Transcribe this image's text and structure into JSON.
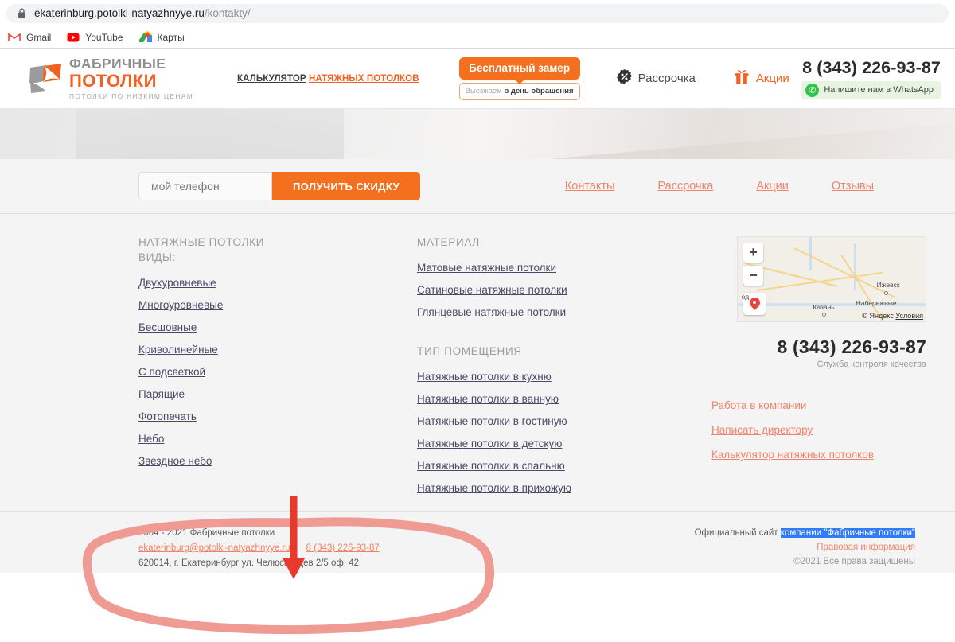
{
  "browser": {
    "lock_icon": "lock-icon",
    "url_host": "ekaterinburg.potolki-natyazhnyye.ru",
    "url_path": "/kontakty/",
    "bookmarks": [
      {
        "label": "Gmail",
        "icon": "gmail-icon"
      },
      {
        "label": "YouTube",
        "icon": "youtube-icon"
      },
      {
        "label": "Карты",
        "icon": "google-maps-icon"
      }
    ]
  },
  "header": {
    "logo": {
      "line1": "ФАБРИЧНЫЕ",
      "line2": "ПОТОЛКИ",
      "tagline": "ПОТОЛКИ ПО НИЗКИМ ЦЕНАМ",
      "mark_gray": "#9b9b9b",
      "mark_orange": "#f26122"
    },
    "calculator_prefix": "КАЛЬКУЛЯТОР",
    "calculator_link": "НАТЯЖНЫХ ПОТОЛКОВ",
    "measure_button": "Бесплатный замер",
    "measure_sub_gray": "Выезжаем",
    "measure_sub_bold": "в день обращения",
    "installment_label": "Рассрочка",
    "installment_icon": "percent-badge-icon",
    "promo_label": "Акции",
    "promo_icon": "gift-icon",
    "phone": "8 (343) 226-93-87",
    "whatsapp_label": "Напишите нам в WhatsApp",
    "whatsapp_icon": "whatsapp-icon",
    "accent": "#f26122"
  },
  "lead": {
    "phone_placeholder": "мой телефон",
    "phone_value": "",
    "discount_button": "ПОЛУЧИТЬ СКИДКУ",
    "nav": [
      {
        "label": "Контакты"
      },
      {
        "label": "Рассрочка"
      },
      {
        "label": "Акции"
      },
      {
        "label": "Отзывы"
      }
    ]
  },
  "footer": {
    "col1": {
      "heading_line1": "НАТЯЖНЫЕ ПОТОЛКИ",
      "heading_line2": "ВИДЫ:",
      "links": [
        "Двухуровневые",
        "Многоуровневые",
        "Бесшовные",
        "Криволинейные",
        "С подсветкой",
        "Парящие",
        "Фотопечать",
        "Небо",
        "Звездное небо"
      ]
    },
    "col2": {
      "heading_material": "МАТЕРИАЛ",
      "material_links": [
        "Матовые натяжные потолки",
        "Сатиновые натяжные потолки",
        "Глянцевые натяжные потолки"
      ],
      "heading_room": "ТИП ПОМЕЩЕНИЯ",
      "room_links": [
        "Натяжные потолки в кухню",
        "Натяжные потолки в ванную",
        "Натяжные потолки в гостиную",
        "Натяжные потолки в детскую",
        "Натяжные потолки в спальню",
        "Натяжные потолки в прихожую"
      ]
    },
    "col3": {
      "map": {
        "zoom_in": "+",
        "zoom_out": "−",
        "pin_icon": "map-pin-icon",
        "labels": [
          "Ижевск",
          "Казань",
          "Набережные",
          "од"
        ],
        "attribution": "© Яндекс",
        "attribution_link": "Условия"
      },
      "phone": "8 (343) 226-93-87",
      "phone_sub": "Служба контроля качества",
      "links": [
        "Работа в компании",
        "Написать директору",
        "Калькулятор натяжных потолков"
      ]
    }
  },
  "bottom": {
    "left_line1": "2004 - 2021 Фабричные потолки",
    "left_email": "ekaterinburg@potolki-natyazhnyye.ru",
    "left_phone": "8 (343) 226-93-87",
    "left_address": "620014, г. Екатеринбург ул. Челюскинцев 2/5 оф. 42",
    "right_prefix": "Официальный сайт ",
    "right_selected": "компании \"Фабричные потолки\"",
    "right_link": "Правовая информация",
    "right_copyright": "©2021 Все права защищены",
    "selection_color": "#2f7cf6"
  },
  "annotations": {
    "arrow_color": "#e8392c",
    "ellipse_color": "#ef9a93",
    "arrow_name": "red-annotation-arrow",
    "ellipse_name": "pink-annotation-ellipse"
  }
}
